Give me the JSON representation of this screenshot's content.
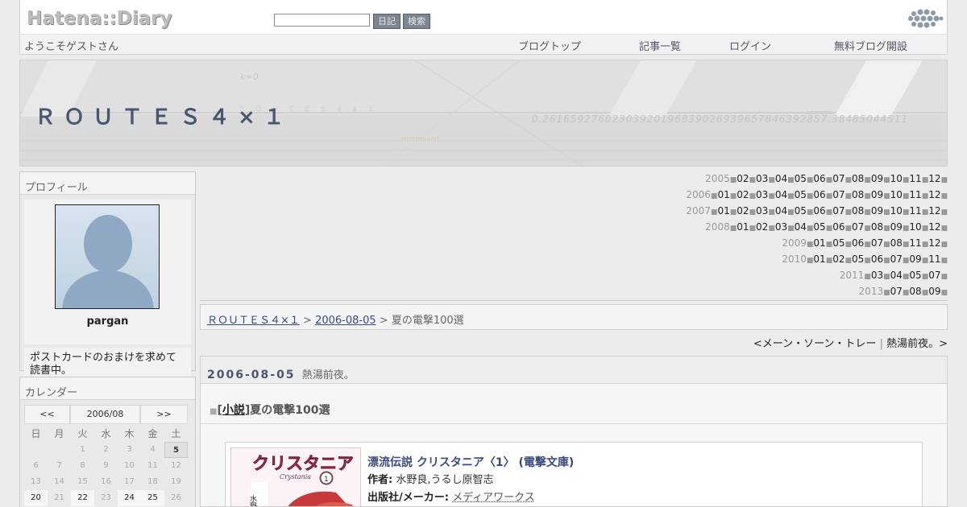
{
  "hatena": {
    "logo": "Hatena::Diary",
    "diary_button": "日記",
    "search_button": "検索",
    "welcome": "ようこそゲストさん",
    "nav": [
      "ブログトップ",
      "記事一覧",
      "ログイン",
      "無料ブログ開設"
    ]
  },
  "banner": {
    "title": "ＲＯＵＴＥＳ４×１",
    "numbers": "0.26165927602303920196839026939657846392857.38485044511",
    "subtext": "k=0"
  },
  "profile": {
    "heading": "プロフィール",
    "username": "pargan",
    "description": "ポストカードのおまけを求めて読書中。"
  },
  "calendar": {
    "heading": "カレンダー",
    "prev": "<<",
    "month": "2006/08",
    "next": ">>",
    "weekdays": [
      "日",
      "月",
      "火",
      "水",
      "木",
      "金",
      "土"
    ],
    "days": [
      "",
      "",
      "1",
      "2",
      "3",
      "4",
      "5",
      "6",
      "7",
      "8",
      "9",
      "10",
      "11",
      "12",
      "13",
      "14",
      "15",
      "16",
      "17",
      "18",
      "19",
      "20",
      "21",
      "22",
      "23",
      "24",
      "25",
      "26"
    ]
  },
  "archive": [
    {
      "year": "2005",
      "months": [
        "02",
        "03",
        "04",
        "05",
        "06",
        "07",
        "08",
        "09",
        "10",
        "11",
        "12"
      ]
    },
    {
      "year": "2006",
      "months": [
        "01",
        "02",
        "03",
        "04",
        "05",
        "06",
        "07",
        "08",
        "09",
        "10",
        "11",
        "12"
      ]
    },
    {
      "year": "2007",
      "months": [
        "01",
        "02",
        "03",
        "04",
        "05",
        "06",
        "07",
        "08",
        "09",
        "10",
        "11",
        "12"
      ]
    },
    {
      "year": "2008",
      "months": [
        "01",
        "02",
        "03",
        "04",
        "05",
        "06",
        "07",
        "08",
        "09",
        "10",
        "12"
      ]
    },
    {
      "year": "2009",
      "months": [
        "01",
        "05",
        "06",
        "07",
        "08",
        "11",
        "12"
      ]
    },
    {
      "year": "2010",
      "months": [
        "01",
        "02",
        "05",
        "06",
        "07",
        "09",
        "11"
      ]
    },
    {
      "year": "2011",
      "months": [
        "03",
        "04",
        "05",
        "07"
      ]
    },
    {
      "year": "2013",
      "months": [
        "07",
        "08",
        "09"
      ]
    }
  ],
  "breadcrumb": {
    "blog": "ＲＯＵＴＥＳ４×１",
    "date": "2006-08-05",
    "sep": ">",
    "current": "夏の電撃100選"
  },
  "pager": {
    "prev": "<メーン・ソーン・トレー",
    "divider": "|",
    "next": "熱湯前夜。>"
  },
  "entry": {
    "date": "2006-08-05",
    "day_title": "熱湯前夜。",
    "section_marker": "■",
    "category_open": "[",
    "category": "小説",
    "category_close": "]",
    "section_title": "夏の電撃100選"
  },
  "book": {
    "title": "漂流伝説 クリスタニア〈1〉 (電撃文庫)",
    "author_label": "作者:",
    "author": "水野良,うるし原智志",
    "publisher_label": "出版社/メーカー:",
    "publisher": "メディアワークス",
    "cover_text": "クリスタニア",
    "cover_sub": "Crystania",
    "cover_number": "1",
    "cover_author": "水野良"
  }
}
